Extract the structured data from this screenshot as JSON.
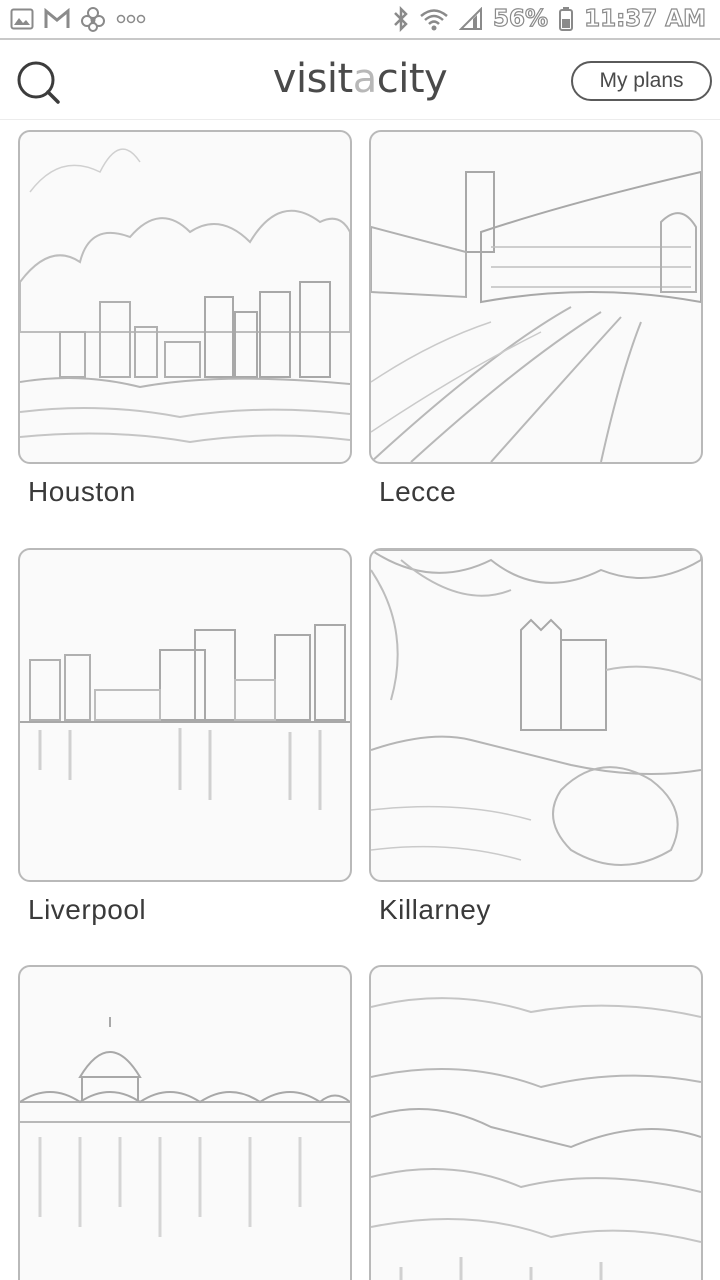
{
  "status_bar": {
    "icons_left": [
      "image-icon",
      "gmail-icon",
      "flower-icon",
      "more-dots-icon"
    ],
    "icons_right": [
      "bluetooth-icon",
      "wifi-icon",
      "signal-icon",
      "battery-icon"
    ],
    "battery": "56%",
    "time": "11:37 AM"
  },
  "header": {
    "logo_left": "visit",
    "logo_mid": "a",
    "logo_right": "city",
    "my_plans_label": "My plans"
  },
  "cities": [
    {
      "name": "Houston"
    },
    {
      "name": "Lecce"
    },
    {
      "name": "Liverpool"
    },
    {
      "name": "Killarney"
    },
    {
      "name": ""
    },
    {
      "name": ""
    }
  ]
}
